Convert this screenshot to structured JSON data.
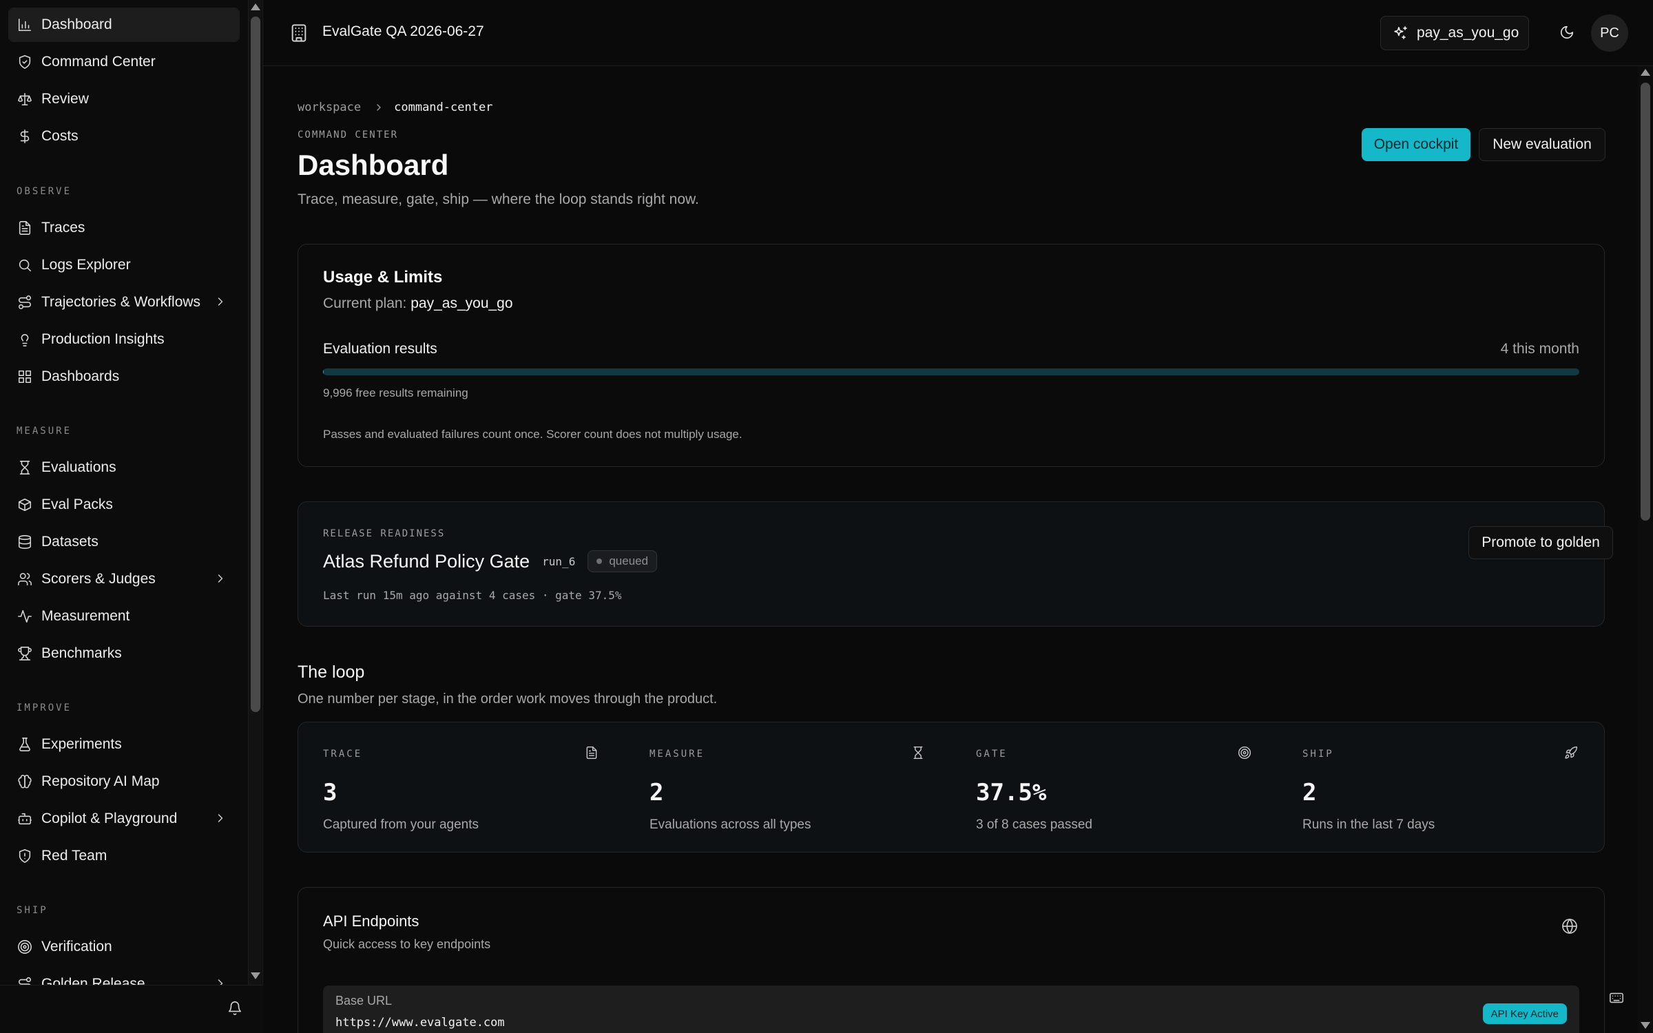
{
  "sidebar": {
    "top_items": [
      {
        "label": "Dashboard",
        "icon": "bar-chart-icon"
      },
      {
        "label": "Command Center",
        "icon": "shield-check-icon"
      },
      {
        "label": "Review",
        "icon": "scale-icon"
      },
      {
        "label": "Costs",
        "icon": "dollar-icon"
      }
    ],
    "sections": [
      {
        "label": "OBSERVE",
        "items": [
          {
            "label": "Traces",
            "icon": "file-text-icon"
          },
          {
            "label": "Logs Explorer",
            "icon": "search-icon"
          },
          {
            "label": "Trajectories & Workflows",
            "icon": "route-icon"
          },
          {
            "label": "Production Insights",
            "icon": "lightbulb-icon"
          },
          {
            "label": "Dashboards",
            "icon": "grid-icon"
          }
        ]
      },
      {
        "label": "MEASURE",
        "items": [
          {
            "label": "Evaluations",
            "icon": "hourglass-icon"
          },
          {
            "label": "Eval Packs",
            "icon": "boxes-icon"
          },
          {
            "label": "Datasets",
            "icon": "database-icon"
          },
          {
            "label": "Scorers & Judges",
            "icon": "users-icon"
          },
          {
            "label": "Measurement",
            "icon": "activity-icon"
          },
          {
            "label": "Benchmarks",
            "icon": "trophy-icon"
          }
        ]
      },
      {
        "label": "IMPROVE",
        "items": [
          {
            "label": "Experiments",
            "icon": "flask-icon"
          },
          {
            "label": "Repository AI Map",
            "icon": "brain-icon"
          },
          {
            "label": "Copilot & Playground",
            "icon": "bot-icon"
          },
          {
            "label": "Red Team",
            "icon": "shield-alert-icon"
          }
        ]
      },
      {
        "label": "SHIP",
        "items": [
          {
            "label": "Verification",
            "icon": "target-icon"
          },
          {
            "label": "Golden Release",
            "icon": "route-icon"
          }
        ]
      }
    ]
  },
  "topbar": {
    "workspace_name": "EvalGate QA 2026-06-27",
    "plan": "pay_as_you_go",
    "avatar_initials": "PC"
  },
  "page": {
    "breadcrumb": {
      "root": "workspace",
      "current": "command-center"
    },
    "eyebrow": "COMMAND CENTER",
    "title": "Dashboard",
    "subtitle": "Trace, measure, gate, ship — where the loop stands right now.",
    "open_cockpit": "Open cockpit",
    "new_evaluation": "New evaluation"
  },
  "usage": {
    "title": "Usage & Limits",
    "plan_prefix": "Current plan:",
    "plan": "pay_as_you_go",
    "metric_label": "Evaluation results",
    "metric_count": "4 this month",
    "progress_fraction": 0.0004,
    "remaining": "9,996 free results remaining",
    "note": "Passes and evaluated failures count once. Scorer count does not multiply usage."
  },
  "release": {
    "eyebrow": "RELEASE READINESS",
    "name": "Atlas Refund Policy Gate",
    "run_id": "run_6",
    "status": "queued",
    "meta": "Last run 15m ago against 4 cases · gate 37.5%",
    "promote": "Promote to golden"
  },
  "loop": {
    "title": "The loop",
    "subtitle": "One number per stage, in the order work moves through the product.",
    "stages": [
      {
        "label": "TRACE",
        "value": "3",
        "desc": "Captured from your agents",
        "icon": "file-text-icon"
      },
      {
        "label": "MEASURE",
        "value": "2",
        "desc": "Evaluations across all types",
        "icon": "hourglass-icon"
      },
      {
        "label": "GATE",
        "value": "37.5%",
        "desc": "3 of 8 cases passed",
        "icon": "target-icon"
      },
      {
        "label": "SHIP",
        "value": "2",
        "desc": "Runs in the last 7 days",
        "icon": "rocket-icon"
      }
    ]
  },
  "api": {
    "title": "API Endpoints",
    "subtitle": "Quick access to key endpoints",
    "base_url_label": "Base URL",
    "base_url": "https://www.evalgate.com",
    "badge": "API Key Active"
  },
  "colors": {
    "accent": "#14b8c8",
    "progress_track": "#103a40"
  }
}
